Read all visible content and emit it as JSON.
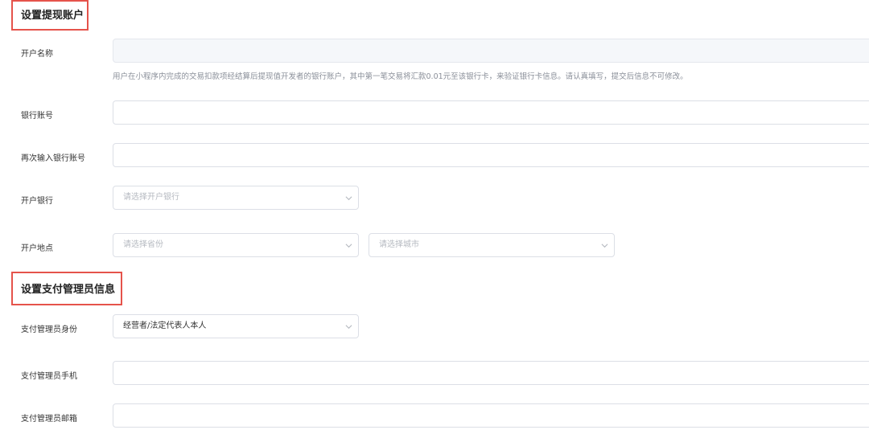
{
  "withdraw_section": {
    "title": "设置提现账户",
    "account_name": {
      "label": "开户名称",
      "value": "",
      "hint": "用户在小程序内完成的交易扣款项经结算后提现值开发者的银行账户，其中第一笔交易将汇款0.01元至该银行卡，来验证银行卡信息。请认真填写，提交后信息不可修改。"
    },
    "bank_account": {
      "label": "银行账号",
      "value": ""
    },
    "bank_account_confirm": {
      "label": "再次输入银行账号",
      "value": ""
    },
    "bank": {
      "label": "开户银行",
      "placeholder": "请选择开户银行"
    },
    "location": {
      "label": "开户地点",
      "province_placeholder": "请选择省份",
      "city_placeholder": "请选择城市"
    }
  },
  "admin_section": {
    "title": "设置支付管理员信息",
    "identity": {
      "label": "支付管理员身份",
      "value": "经营者/法定代表人本人"
    },
    "phone": {
      "label": "支付管理员手机",
      "value": ""
    },
    "email": {
      "label": "支付管理员邮箱",
      "value": ""
    }
  },
  "colors": {
    "highlight_border": "#e5534b",
    "input_border": "#dcdfe6",
    "disabled_bg": "#f5f7fa",
    "placeholder": "#b5b9c0",
    "hint_text": "#8a8f99"
  },
  "icons": {
    "dropdown": "chevron-down-icon"
  }
}
